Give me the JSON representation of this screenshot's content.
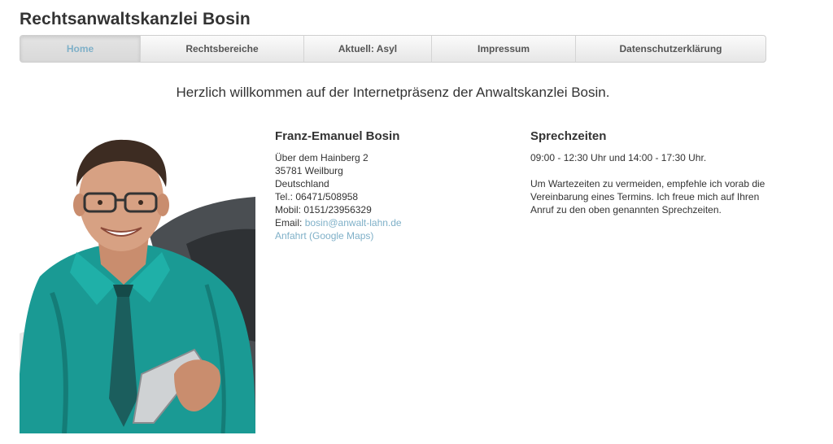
{
  "site_title": "Rechtsanwaltskanzlei Bosin",
  "nav": {
    "items": [
      {
        "label": "Home"
      },
      {
        "label": "Rechtsbereiche"
      },
      {
        "label": "Aktuell: Asyl"
      },
      {
        "label": "Impressum"
      },
      {
        "label": "Datenschutzerklärung"
      }
    ]
  },
  "welcome": "Herzlich willkommen auf der Internetpräsenz der Anwaltskanzlei Bosin.",
  "contact": {
    "name": "Franz-Emanuel Bosin",
    "street": "Über dem Hainberg 2",
    "city": "35781 Weilburg",
    "country": "Deutschland",
    "tel": "Tel.: 06471/508958",
    "mobile": "Mobil: 0151/23956329",
    "email_prefix": "Email: ",
    "email": "bosin@anwalt-lahn.de",
    "maps_link": "Anfahrt (Google Maps)"
  },
  "hours": {
    "title": "Sprechzeiten",
    "times": "09:00 - 12:30 Uhr und 14:00 - 17:30 Uhr.",
    "note": "Um Wartezeiten zu vermeiden, empfehle ich vorab die Vereinbarung eines Termins. Ich freue mich auf Ihren Anruf zu den oben genannten Sprechzeiten."
  },
  "colors": {
    "accent_link": "#7fb0c8",
    "shirt": "#1a9a94"
  }
}
